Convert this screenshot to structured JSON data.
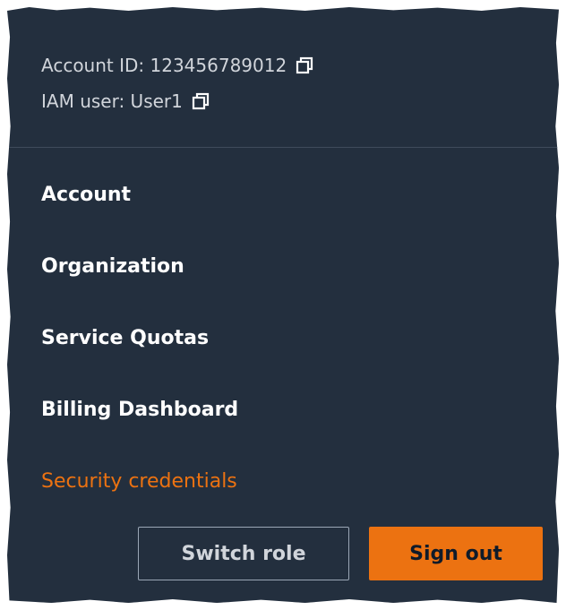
{
  "account": {
    "account_id_label": "Account ID: 123456789012",
    "iam_user_label": "IAM user: User1"
  },
  "menu": {
    "items": [
      {
        "label": "Account"
      },
      {
        "label": "Organization"
      },
      {
        "label": "Service Quotas"
      },
      {
        "label": "Billing Dashboard"
      },
      {
        "label": "Security credentials"
      }
    ]
  },
  "buttons": {
    "switch_role": "Switch role",
    "sign_out": "Sign out"
  },
  "colors": {
    "panel_bg": "#232f3e",
    "accent": "#ec7211",
    "text_muted": "#d1d5db",
    "text_primary": "#ffffff"
  },
  "icons": {
    "copy": "copy-icon"
  }
}
